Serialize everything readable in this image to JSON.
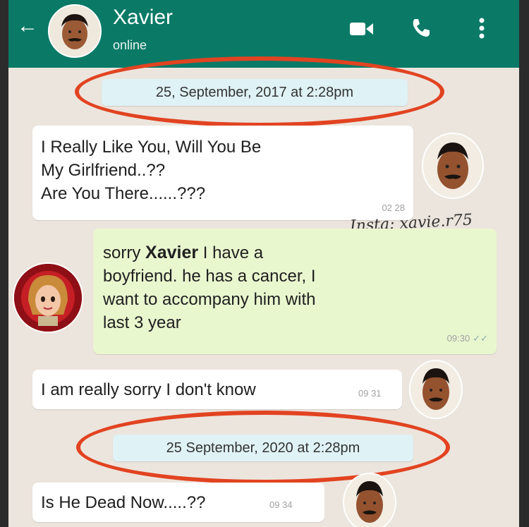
{
  "header": {
    "contact_name": "Xavier",
    "status": "online"
  },
  "dates": {
    "first": "25, September, 2017 at 2:28pm",
    "second": "25 September, 2020 at 2:28pm"
  },
  "watermark": "Insta: xavie.r75",
  "messages": [
    {
      "text": "I Really Like You, Will You Be\nMy Girlfriend..??\nAre You There......???",
      "time": "02 28"
    },
    {
      "text_before": "sorry",
      "name": "Xavier",
      "text_after": "I have a\nboyfriend. he has a cancer, I\nwant to accompany him with\nlast 3 year",
      "time": "09:30"
    },
    {
      "text": "I am really sorry I don't know",
      "time": "09 31"
    },
    {
      "text": "Is He Dead Now.....??",
      "time": "09 34"
    }
  ],
  "colors": {
    "header": "#0a7a67",
    "chat_bg": "#ece5dd",
    "outgoing_bubble": "#e9f7cf",
    "highlight_circle": "#e24321"
  },
  "icons": [
    "back-arrow-icon",
    "video-call-icon",
    "phone-icon",
    "more-vertical-icon",
    "double-tick-icon"
  ]
}
